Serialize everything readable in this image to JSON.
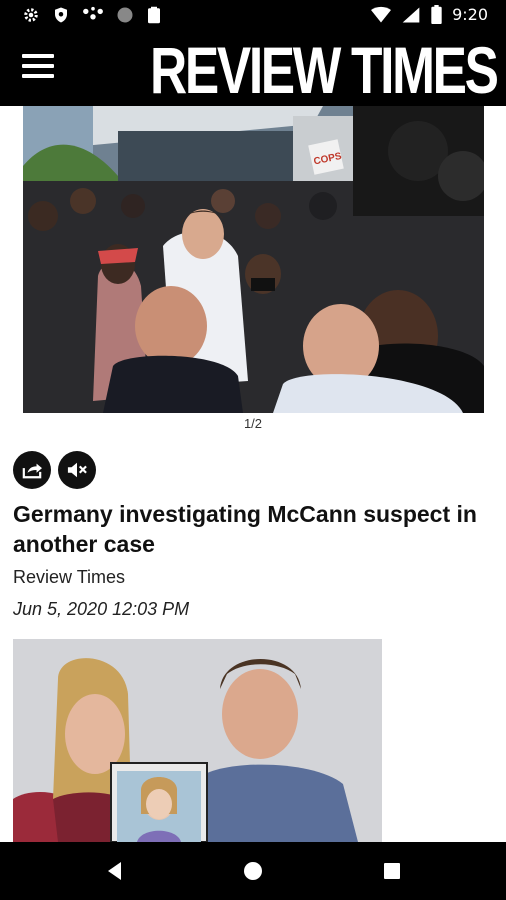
{
  "status_bar": {
    "time": "9:20",
    "left_icons": [
      "gear-icon",
      "shield-icon",
      "fitness-icon",
      "circle-icon",
      "clipboard-icon"
    ],
    "right_icons": [
      "wifi-icon",
      "signal-icon",
      "battery-icon"
    ]
  },
  "app_bar": {
    "brand": "REVIEW TIMES",
    "menu_icon": "hamburger-menu-icon"
  },
  "gallery": {
    "counter": "1/2",
    "protest_sign": "COPS"
  },
  "article": {
    "headline": "Germany investigating McCann suspect in another case",
    "source": "Review Times",
    "date": "Jun 5, 2020 12:03 PM",
    "actions": [
      "share-icon",
      "mute-icon"
    ]
  },
  "nav_bar": {
    "buttons": [
      "back-icon",
      "home-icon",
      "recents-icon"
    ]
  }
}
